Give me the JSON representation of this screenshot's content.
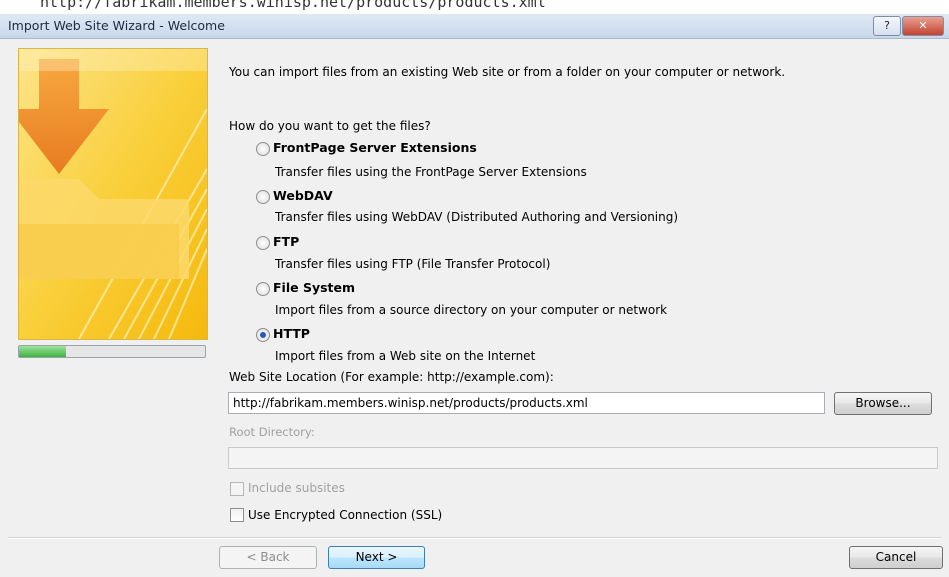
{
  "top_strip_text": "http://fabrikam.members.winisp.net/products/products.xml",
  "window": {
    "title": "Import Web Site Wizard - Welcome",
    "help_glyph": "?",
    "close_glyph": "✕"
  },
  "intro": "You can import files from an existing Web site or from a folder on your computer or network.",
  "question": "How do you want to get the files?",
  "options": [
    {
      "label": "FrontPage Server Extensions",
      "description": "Transfer files using the FrontPage Server Extensions",
      "selected": false
    },
    {
      "label": "WebDAV",
      "description": "Transfer files using WebDAV (Distributed Authoring and Versioning)",
      "selected": false
    },
    {
      "label": "FTP",
      "description": "Transfer files using FTP (File Transfer Protocol)",
      "selected": false
    },
    {
      "label": "File System",
      "description": "Import files from a source directory on your computer or network",
      "selected": false
    },
    {
      "label": "HTTP",
      "description": "Import files from a Web site on the Internet",
      "selected": true
    }
  ],
  "location": {
    "label": "Web Site Location (For example: http://example.com):",
    "value": "http://fabrikam.members.winisp.net/products/products.xml",
    "browse_label": "Browse..."
  },
  "root_directory": {
    "label": "Root Directory:",
    "value": ""
  },
  "include_subsites": {
    "label": "Include subsites",
    "checked": false,
    "enabled": false
  },
  "use_ssl": {
    "label": "Use Encrypted Connection (SSL)",
    "checked": false,
    "enabled": true
  },
  "progress_fraction": 0.25,
  "buttons": {
    "back": "< Back",
    "next": "Next >",
    "cancel": "Cancel"
  },
  "colors": {
    "accent": "#f7c21c",
    "progress": "#3db33d",
    "title_bar": "#d4e1f1"
  }
}
